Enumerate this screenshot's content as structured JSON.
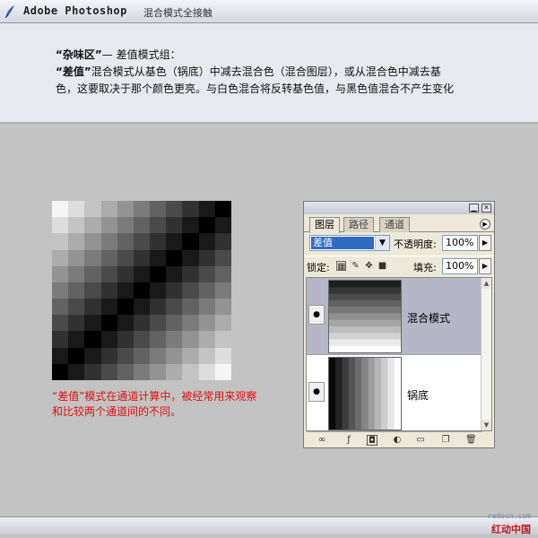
{
  "header": {
    "title": "Adobe Photoshop",
    "subtitle": "混合模式全接触"
  },
  "description": {
    "line1_a": "“杂味区”",
    "line1_b": "— 差值模式组：",
    "line2_a": "“差值”",
    "line2_b": "混合模式从基色（锅底）中减去混合色（混合图层），或从混合色中减去基",
    "line3": "色，这要取决于那个颜色更亮。与白色混合将反转基色值，与黑色值混合不产生变化"
  },
  "note": "“差值”模式在通道计算中，被经常用来观察和比较两个通道间的不同。",
  "palette": {
    "tabs": [
      "图层",
      "路径",
      "通道"
    ],
    "blend_mode": "差值",
    "opacity_label": "不透明度:",
    "opacity_value": "100%",
    "lock_label": "锁定:",
    "fill_label": "填充:",
    "fill_value": "100%",
    "layers": [
      {
        "name": "混合模式",
        "selected": true
      },
      {
        "name": "锅底",
        "selected": false
      }
    ]
  },
  "watermark": {
    "url": "redocn.com",
    "text": "红动中国"
  }
}
